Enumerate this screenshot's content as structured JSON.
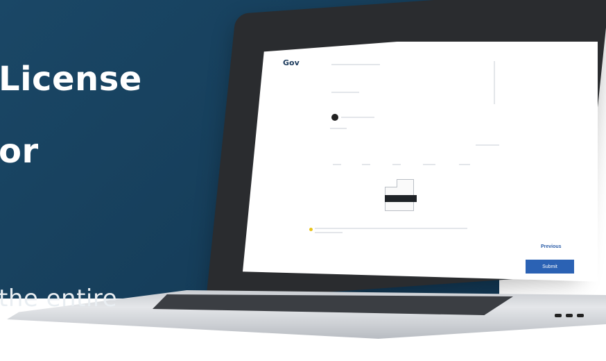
{
  "hero": {
    "line1": "License",
    "line2": "or",
    "line3": "the entire"
  },
  "laptop_screen": {
    "logo_main": "Gov",
    "logo_sub": "",
    "tooltip_label": "",
    "previous_label": "Previous",
    "submit_label": "Submit"
  },
  "colors": {
    "hero_blue": "#17405d",
    "submit_blue": "#2b62b4",
    "previous_blue": "#2b5da8",
    "warning_yellow": "#e8c21a"
  },
  "icons": [
    "user-avatar-icon",
    "warning-icon",
    "map-shape-icon"
  ]
}
